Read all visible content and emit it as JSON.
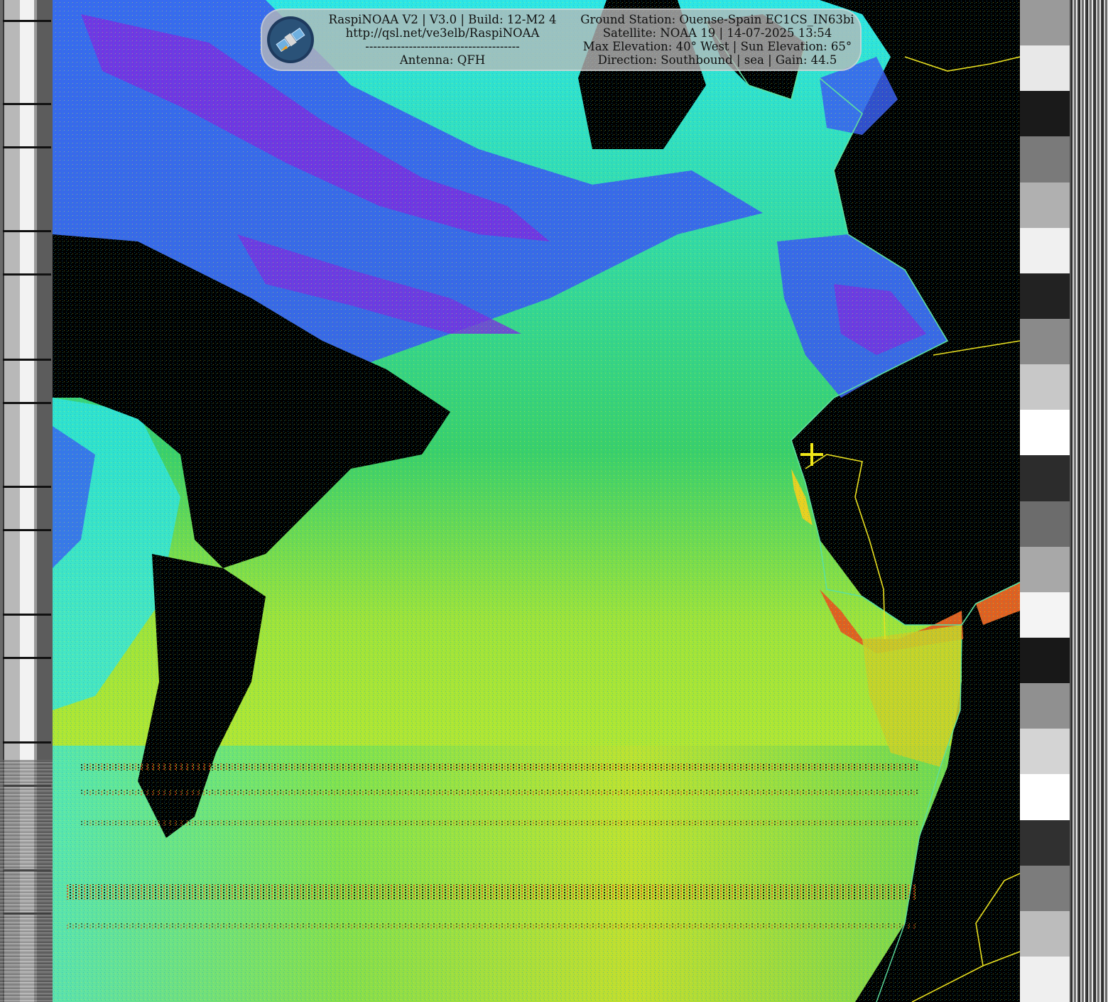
{
  "banner": {
    "app_line": "RaspiNOAA V2 | V3.0 | Build: 12-M2 4",
    "url_line": "http://qsl.net/ve3elb/RaspiNOAA",
    "separator_line": "---------------------------------------",
    "antenna_line": "Antenna: QFH",
    "station_line": "Ground Station: Ouense-Spain EC1CS_IN63bi",
    "satellite_line": "Satellite: NOAA 19 | 14-07-2025 13:54",
    "elevation_line": "Max Elevation: 40° West | Sun Elevation: 65°",
    "direction_line": "Direction: Southbound | sea | Gain: 44.5",
    "logo_icon": "satellite-logo-icon"
  },
  "image": {
    "marker_icon": "yellow-crosshair-icon",
    "palette": {
      "cloud_cold": "#7a2ee0",
      "cloud_mid": "#3a5cf0",
      "cyan": "#2ee6e6",
      "green": "#3ad06a",
      "yellow_green": "#b8e830",
      "warm": "#e06020",
      "land": "#000000",
      "border": "#e8e020",
      "coast": "#5ce0a0"
    }
  }
}
